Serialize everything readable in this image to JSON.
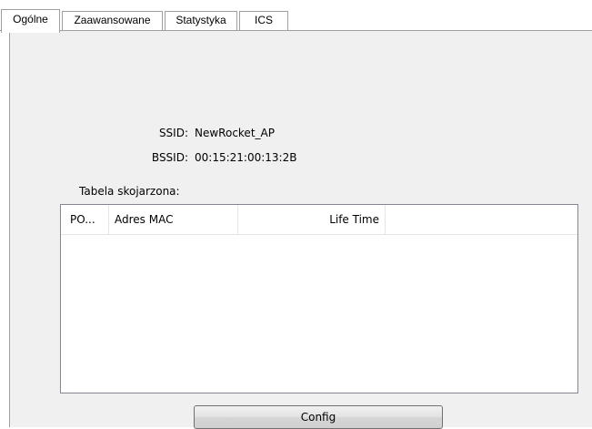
{
  "tabs": [
    {
      "label": "Ogólne",
      "active": true
    },
    {
      "label": "Zaawansowane",
      "active": false
    },
    {
      "label": "Statystyka",
      "active": false
    },
    {
      "label": "ICS",
      "active": false
    }
  ],
  "general": {
    "ssid_label": "SSID:",
    "ssid_value": "NewRocket_AP",
    "bssid_label": "BSSID:",
    "bssid_value": "00:15:21:00:13:2B",
    "association_table_label": "Tabela skojarzona:"
  },
  "table": {
    "columns": [
      "PO...",
      "Adres MAC",
      "Life Time"
    ],
    "rows": []
  },
  "buttons": {
    "config_label": "Config"
  }
}
